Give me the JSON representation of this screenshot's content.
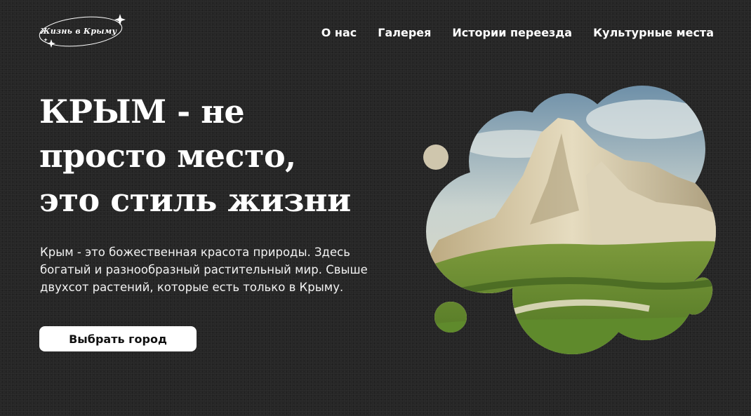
{
  "logo": {
    "text": "Жизнь в Крыму"
  },
  "nav": [
    {
      "label": "О нас"
    },
    {
      "label": "Галерея"
    },
    {
      "label": "Истории переезда"
    },
    {
      "label": "Культурные места"
    }
  ],
  "hero": {
    "title_lines": [
      "КРЫМ - не",
      "просто место,",
      "это стиль жизни"
    ],
    "description": "Крым - это божественная красота природы. Здесь богатый и разнообразный растительный мир. Свыше двухсот растений, которые есть только в Крыму.",
    "cta_label": "Выбрать город"
  },
  "colors": {
    "background": "#262626",
    "text": "#ffffff",
    "button_bg": "#ffffff",
    "button_text": "#111111"
  },
  "image": {
    "subject": "white cliff mountain with green meadow under cloudy sky"
  }
}
